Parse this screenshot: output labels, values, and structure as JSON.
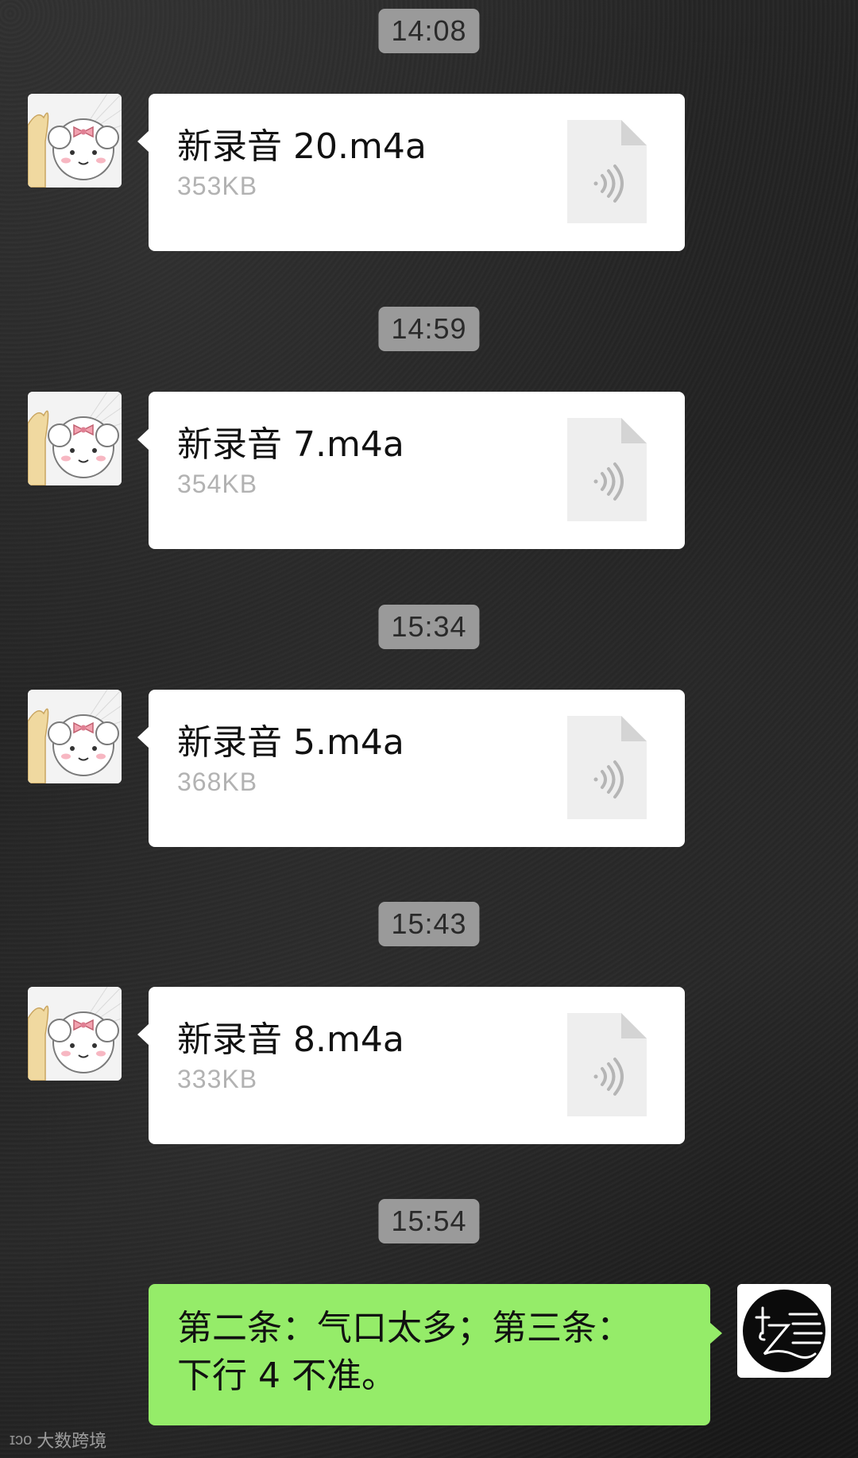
{
  "chat": {
    "messages": [
      {
        "time": "14:08",
        "file_name": "新录音 20.m4a",
        "file_size": "353KB"
      },
      {
        "time": "14:59",
        "file_name": "新录音 7.m4a",
        "file_size": "354KB"
      },
      {
        "time": "15:34",
        "file_name": "新录音 5.m4a",
        "file_size": "368KB"
      },
      {
        "time": "15:43",
        "file_name": "新录音 8.m4a",
        "file_size": "333KB"
      }
    ],
    "reply": {
      "time": "15:54",
      "line1": "第二条：气口太多；第三条：",
      "line2": "下行 4 不准。"
    }
  },
  "icons": {
    "file": "audio-file-icon",
    "left_avatar": "cartoon-dog-avatar",
    "right_avatar": "music-logo-avatar"
  },
  "watermark": {
    "logo": "ɪɔᴏ",
    "text": "大数跨境"
  },
  "colors": {
    "bubble_sent": "#95ec69",
    "bubble_received": "#ffffff",
    "timestamp_bg": "#9a9a9a",
    "file_size_text": "#b2b2b2"
  }
}
